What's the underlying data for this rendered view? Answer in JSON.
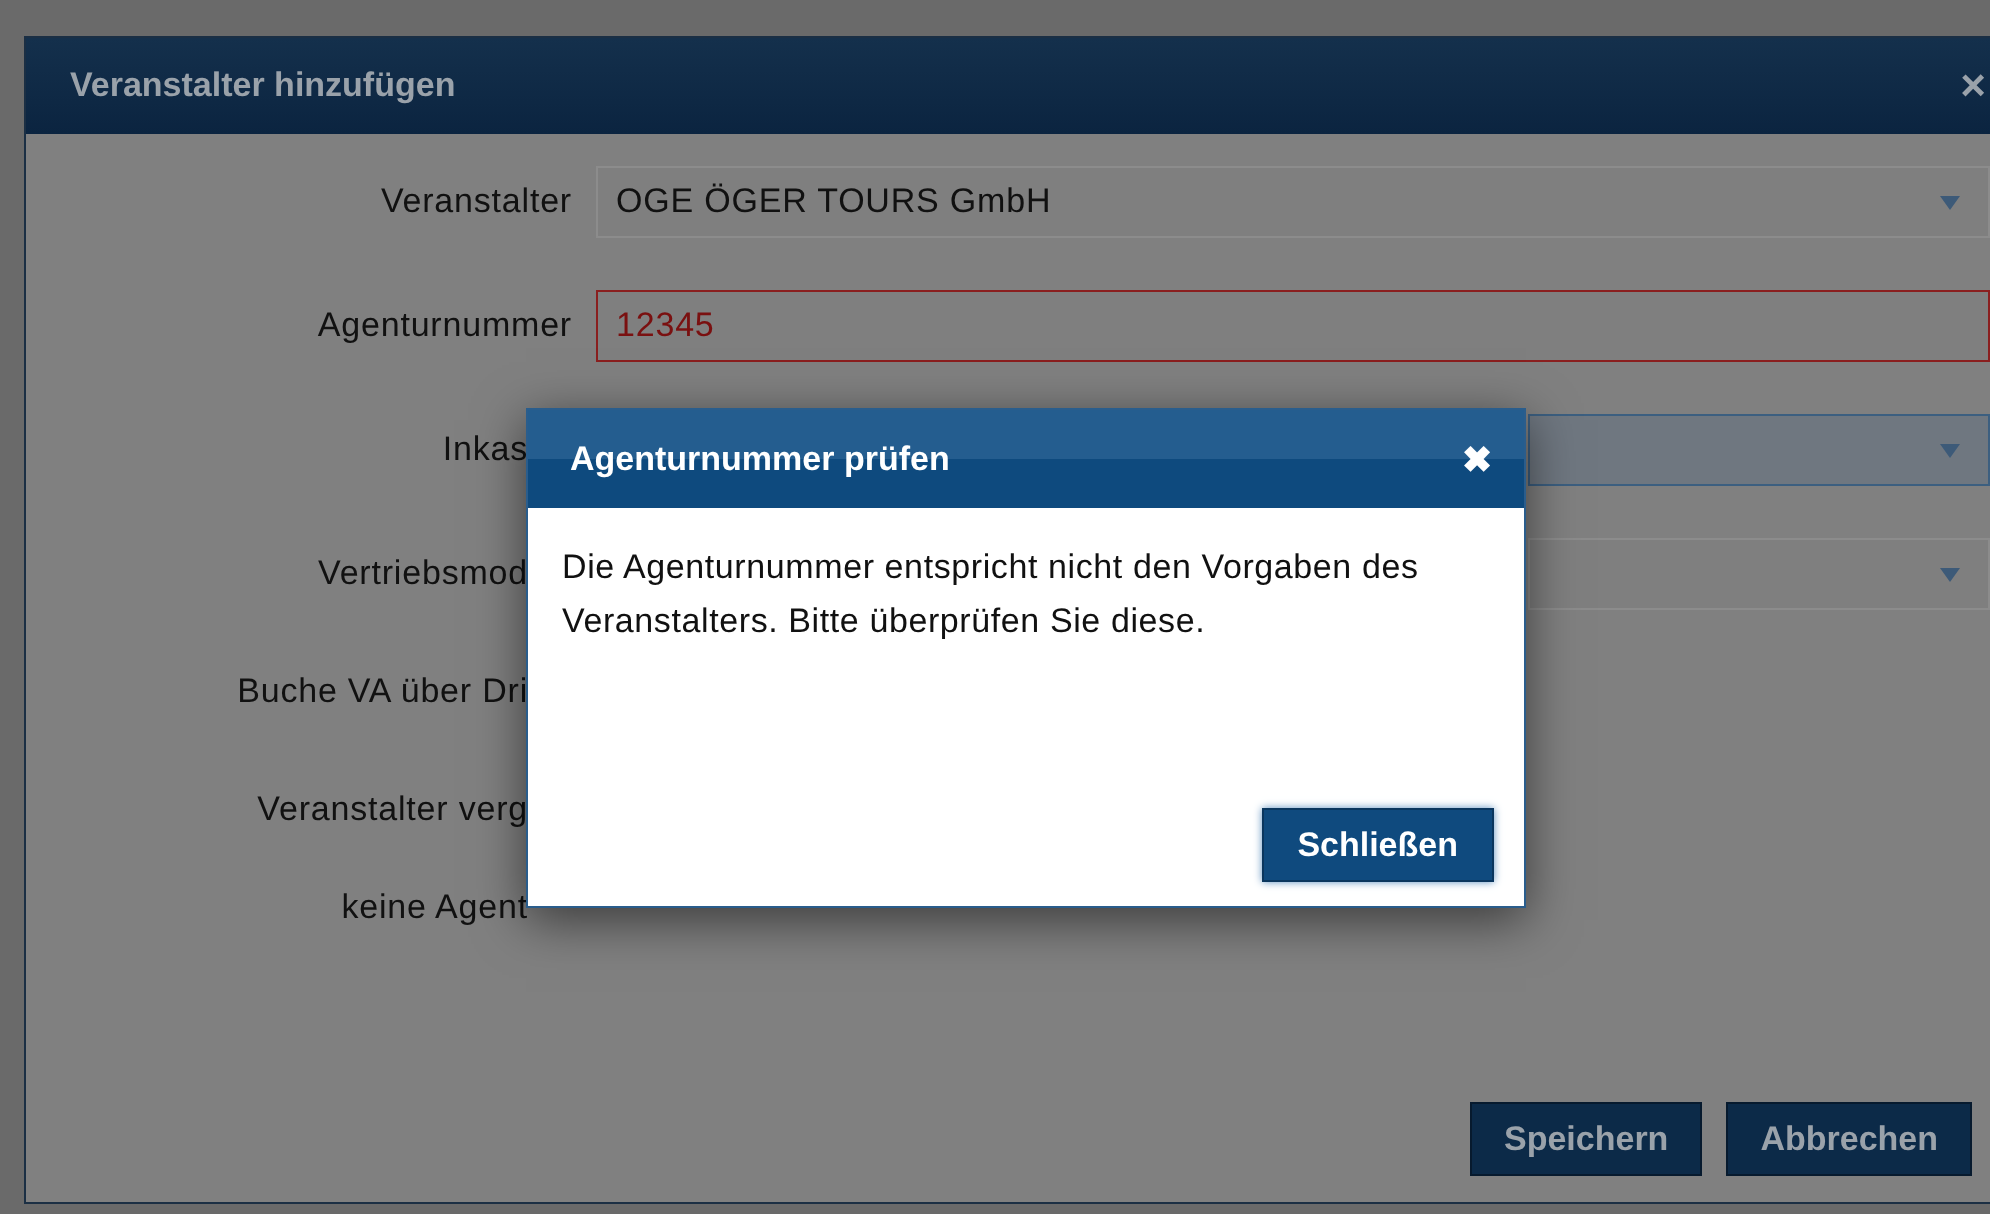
{
  "dialog": {
    "title": "Veranstalter hinzufügen",
    "close_icon": "×",
    "rows": [
      {
        "label": "Veranstalter",
        "covered": false,
        "field": {
          "kind": "select",
          "value": "OGE ÖGER TOURS GmbH",
          "error": false,
          "focused": false
        }
      },
      {
        "label": "Agenturnummer",
        "covered": false,
        "field": {
          "kind": "text",
          "value": "12345",
          "error": true,
          "focused": false
        }
      },
      {
        "label": "Inkas",
        "covered": true,
        "field": {
          "kind": "select",
          "error": false,
          "focused": true
        }
      },
      {
        "label": "Vertriebsmod",
        "covered": true,
        "field": {
          "kind": "select",
          "error": false,
          "focused": false
        }
      },
      {
        "label": "Buche VA über Dri",
        "covered": true
      },
      {
        "label": "Veranstalter verg",
        "covered": true
      },
      {
        "label": "keine Agent",
        "covered": true
      }
    ],
    "buttons": [
      {
        "label": "Speichern"
      },
      {
        "label": "Abbrechen"
      }
    ]
  },
  "modal": {
    "title": "Agenturnummer prüfen",
    "close_icon": "✖",
    "message": "Die Agenturnummer entspricht nicht den Vorgaben des Veranstalters. Bitte überprüfen Sie diese.",
    "button": "Schließen"
  }
}
